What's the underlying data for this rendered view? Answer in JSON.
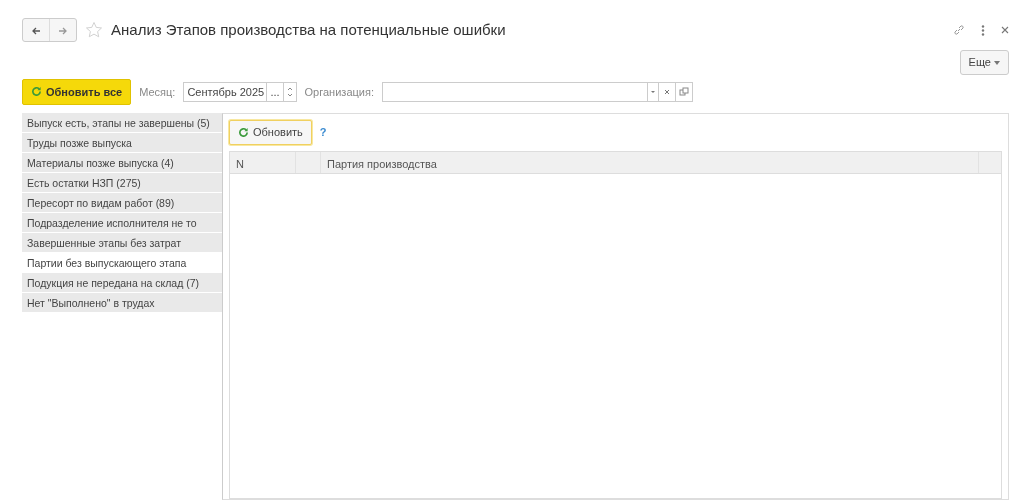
{
  "window": {
    "title": "Анализ Этапов производства на потенциальные ошибки",
    "more_button": "Еще"
  },
  "toolbar": {
    "refresh_all": "Обновить все",
    "month_label": "Месяц:",
    "month_value": "Сентябрь 2025",
    "month_choose": "...",
    "org_label": "Организация:"
  },
  "sections": [
    {
      "label": "Выпуск есть, этапы не завершены (5)",
      "selected": false
    },
    {
      "label": "Труды позже выпуска",
      "selected": false
    },
    {
      "label": "Материалы позже выпуска (4)",
      "selected": false
    },
    {
      "label": "Есть остатки НЗП (275)",
      "selected": false
    },
    {
      "label": "Пересорт по видам работ (89)",
      "selected": false
    },
    {
      "label": "Подразделение исполнителя не то",
      "selected": false
    },
    {
      "label": "Завершенные этапы без затрат",
      "selected": false
    },
    {
      "label": "Партии без выпускающего этапа",
      "selected": true
    },
    {
      "label": "Подукция не передана на склад (7)",
      "selected": false
    },
    {
      "label": "Нет \"Выполнено\" в трудах",
      "selected": false
    }
  ],
  "panel": {
    "refresh": "Обновить",
    "help": "?",
    "table": {
      "columns": [
        "N",
        "Партия производства"
      ]
    }
  }
}
